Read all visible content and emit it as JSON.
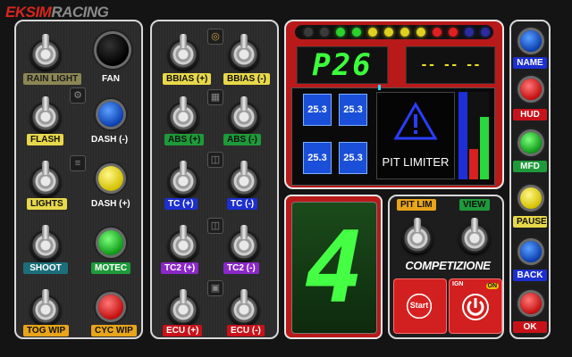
{
  "brand": {
    "part1": "EKSIM",
    "part2": "RACING"
  },
  "left_panel": {
    "labels": [
      "RAIN LIGHT",
      "FAN",
      "FLASH",
      "DASH (-)",
      "LIGHTS",
      "DASH (+)",
      "SHOOT",
      "MOTEC",
      "TOG WIP",
      "CYC WIP"
    ]
  },
  "mid_panel": {
    "labels": [
      "BBIAS (+)",
      "BBIAS (-)",
      "ABS (+)",
      "ABS (-)",
      "TC (+)",
      "TC (-)",
      "TC2 (+)",
      "TC2 (-)",
      "ECU (+)",
      "ECU (-)"
    ]
  },
  "dash": {
    "page_code": "P26",
    "right_readout": "-- -- --",
    "tyre_temps": [
      "25.3",
      "25.3",
      "25.3",
      "25.3"
    ],
    "pit_limiter_label": "PIT LIMITER",
    "gear": "4",
    "rev_leds": [
      "#3a3a3a",
      "#3a3a3a",
      "#2bd12b",
      "#2bd12b",
      "#e0d020",
      "#e0d020",
      "#e0d020",
      "#e0d020",
      "#e02020",
      "#e02020",
      "#2b2b9f",
      "#2b2b9f"
    ]
  },
  "bottom_right": {
    "pit_lim_label": "PIT LIM",
    "view_label": "VIEW",
    "logo_text": "COMPETIZIONE",
    "start_label": "Start",
    "ign_label": "IGN",
    "on_label": "ON"
  },
  "right_column": {
    "labels": [
      "NAME",
      "HUD",
      "MFD",
      "PAUSE",
      "BACK",
      "OK"
    ]
  },
  "colors": {
    "label_yellow": "#e8d84a",
    "label_green": "#1e9a3a",
    "label_blue": "#1c2fd0",
    "label_purple": "#8a28c8",
    "label_red": "#c8121a",
    "label_teal": "#1c6f7a"
  }
}
